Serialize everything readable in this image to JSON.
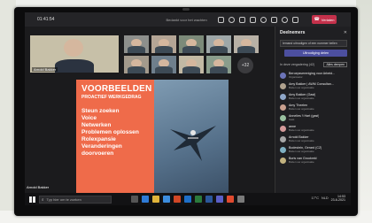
{
  "colors": {
    "accent": "#4c4f9f",
    "leave": "#c4314b",
    "slide_orange": "#ef6b4a"
  },
  "topbar": {
    "time": "01:41:54",
    "meeting_title": "Bedankt voor het wachten",
    "leave_label": "Verlaten",
    "icons": [
      "people-icon",
      "chat-icon",
      "hand-icon",
      "rooms-icon",
      "more-icon",
      "camera-icon",
      "mic-icon",
      "share-icon"
    ]
  },
  "stage": {
    "main_speaker_name": "Arnold Bakker",
    "more_count": "+32",
    "presenter_label": "Arnold Bakker"
  },
  "slide": {
    "title": "VOORBEELDEN",
    "subtitle": "PROACTIEF WERKGEDRAG",
    "items": [
      "Steun zoeken",
      "Voice",
      "Netwerken",
      "Problemen oplossen",
      "Rolexpansie",
      "Veranderingen doorvoeren"
    ]
  },
  "panel": {
    "title": "Deelnemers",
    "share_link": "Iemand uitnodigen of een nummer bellen",
    "invite_label": "Uitnodiging delen",
    "section_title": "In deze vergadering (42)",
    "mute_all": "Alles dempen",
    "participants": [
      {
        "name": "Beroepsvereniging voor Arbeid...",
        "role": "Organisator"
      },
      {
        "name": "Amy Bakker | AWM Consultan...",
        "role": "Buiten uw organisatie"
      },
      {
        "name": "Amy Bakker (Gast)",
        "role": "Buiten uw organisatie"
      },
      {
        "name": "Amy Theelen",
        "role": "Buiten uw organisatie"
      },
      {
        "name": "Annelies 't Hart (gast)",
        "role": "Gast"
      },
      {
        "name": "anne",
        "role": "Buiten uw organisatie"
      },
      {
        "name": "Arnold Bakker",
        "role": "Buiten uw organisatie"
      },
      {
        "name": "Bodestein, Gerard (CZ)",
        "role": "Buiten uw organisatie"
      },
      {
        "name": "Boris van Grootveld",
        "role": "Buiten uw organisatie"
      }
    ]
  },
  "taskbar": {
    "search_placeholder": "Typ hier om te zoeken",
    "weather": "17°C",
    "tray_lang": "NLD",
    "time": "14:53",
    "date": "23-6-2021"
  }
}
